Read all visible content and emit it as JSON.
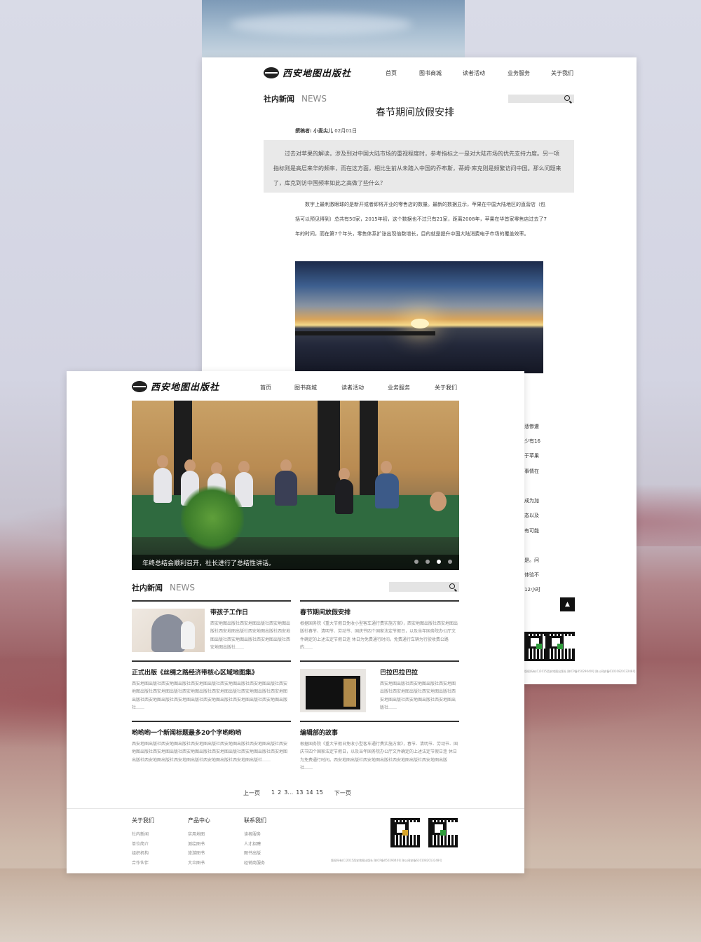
{
  "brand": {
    "name": "西安地图出版社"
  },
  "nav": [
    "首页",
    "图书商城",
    "读者活动",
    "业务服务",
    "关于我们"
  ],
  "section": {
    "cn": "社内新闻",
    "en": "NEWS"
  },
  "article": {
    "title": "春节期间放假安排",
    "byline_label": "撰稿者:",
    "author": "小麦尖儿",
    "date": "02月01日",
    "quote": "过去对苹果的解读，涉及到对中国大陆市场的重视程度时，参考指标之一是对大陆市场的优先支持力度。另一项指标则是高层来华的频率，而在这方面，相比生前从未踏入中国的乔布斯，蒂姆·库克则是频繁访问中国。那么问题来了，库克到访中国频率如此之高做了些什么？",
    "body": "数字上最刺激眼球的是新开或者即将开业的零售店的数量。最新的数据显示，苹果在中国大陆地区的直营店（包括可以预见得到）总共有50家，2015年初，这个数据也不过只有21家，距离2008年，苹果在华首家零售店过去了7年的时间，而在第7个年头，零售体系扩张出现倍数增长，目的就是提升中国大陆消费电子市场的覆盖效率。",
    "fragments": [
      "悲惨遭",
      "少有16",
      "于苹果",
      "事情在",
      "成为加",
      "态以及",
      "有可能",
      "是。问",
      "体验不",
      "12小时"
    ],
    "copyright": "版权所有(C)2015西安地图出版社 陕ICP备05029040号 陕公网安备6101082013248号"
  },
  "totop_icon": "arrow-up-icon",
  "hero": {
    "caption": "年终总结会顺利召开，社长进行了总结性讲话。",
    "slides": 4,
    "active_slide": 3
  },
  "news": [
    {
      "title": "带孩子工作日",
      "text": "西安地图出版社西安地图出版社西安地图出版社西安地图出版社西安地图出版社西安地图出版社西安地图出版社西安地图出版社西安地图出版社……"
    },
    {
      "title": "春节期间放假安排",
      "text": "根据国务院《重大节假日免收小型客车通行费实施方案》，西安地图出版社西安地图出版社春节、清明节、劳动节、国庆节四个国家法定节假日，以及当年国务院办公厅文件确定的上述法定节假日连 休日为免费通行时间。免费通行车辆为行驶收费公路的……"
    },
    {
      "title": "正式出版《丝绸之路经济带核心区域地图集》",
      "text": "西安地图出版社西安地图出版社西安地图出版社西安地图出版社西安地图出版社西安地图出版社西安地图出版社西安地图出版社西安地图出版社西安地图出版社西安地图出版社西安地图出版社西安地图出版社西安地图出版社西安地图出版社西安地图出版社……"
    },
    {
      "title": "巴拉巴拉巴拉",
      "text": "西安地图出版社西安地图出版社西安地图出版社西安地图出版社西安地图出版社西安地图出版社西安地图出版社西安地图出版社……"
    },
    {
      "title": "哟哟哟一个新闻标题最多20个字哟哟哟",
      "text": "西安地图出版社西安地图出版社西安地图出版社西安地图出版社西安地图出版社西安地图出版社西安地图出版社西安地图出版社西安地图出版社西安地图出版社西安地图出版社西安地图出版社西安地图出版社西安地图出版社西安地图出版社……"
    },
    {
      "title": "编辑部的故事",
      "text": "根据国务院《重大节假日免收小型客车通行费实施方案》，春节、清明节、劳动节、国庆节四个国家法定节假日，以及当年国务院办公厅文件确定的上述法定节假日连 休日为免费通行时间。西安地图出版社西安地图出版社西安地图出版社西安地图出版社……"
    }
  ],
  "pager": {
    "prev": "上一页",
    "pages": [
      "1",
      "2",
      "3…",
      "13",
      "14",
      "15"
    ],
    "next": "下一页"
  },
  "footer": {
    "cols": [
      {
        "title": "关于我们",
        "items": [
          "社内新闻",
          "单位简介",
          "组织机构",
          "合作伙伴"
        ]
      },
      {
        "title": "产品中心",
        "items": [
          "实用地图",
          "测绘图书",
          "旅游图书",
          "大众图书"
        ]
      },
      {
        "title": "联系我们",
        "items": [
          "读者服务",
          "人才招聘",
          "图书出版",
          "经销商服务"
        ]
      }
    ],
    "copyright": "版权所有(C)2015西安地图出版社 陕ICP备05029040号 陕公网安备6101082013248号"
  }
}
